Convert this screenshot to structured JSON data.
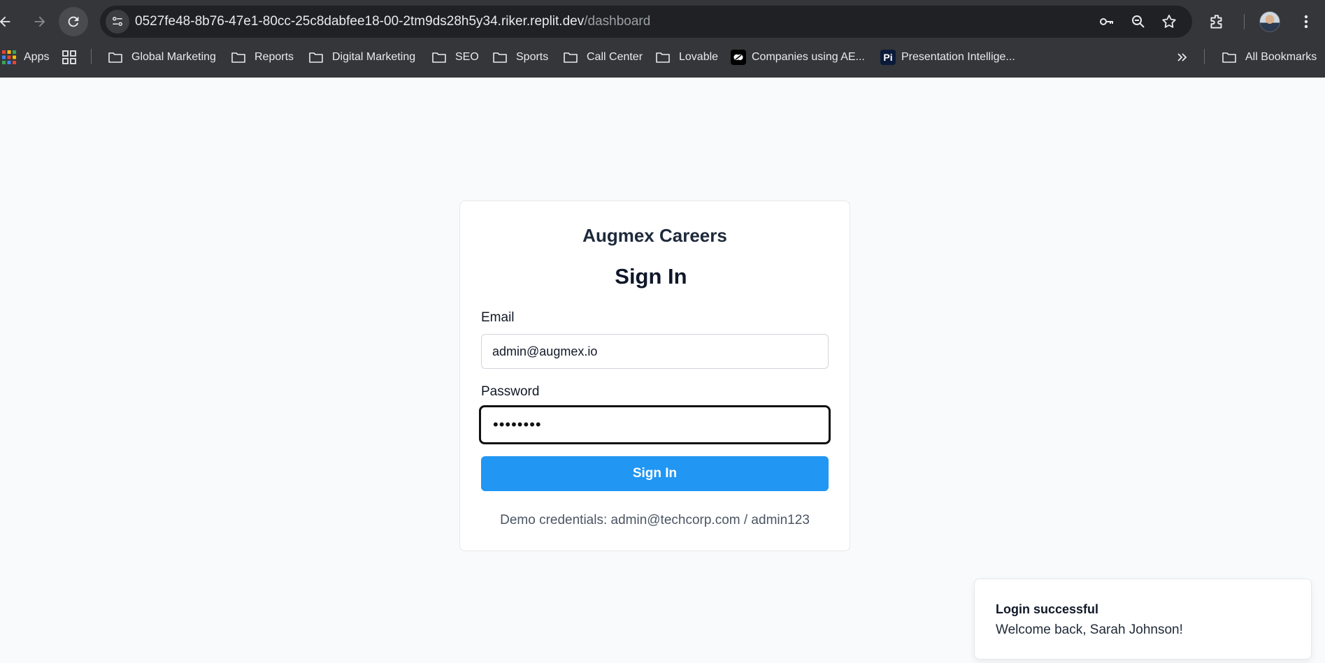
{
  "browser": {
    "url_host": "0527fe48-8b76-47e1-80cc-25c8dabfee18-00-2tm9ds28h5y34.riker.replit.dev",
    "url_path": "/dashboard",
    "bookmarks": [
      {
        "label": "Apps",
        "icon": "apps-grid-icon"
      },
      {
        "label": "Global Marketing",
        "icon": "folder-icon"
      },
      {
        "label": "Reports",
        "icon": "folder-icon"
      },
      {
        "label": "Digital Marketing",
        "icon": "folder-icon"
      },
      {
        "label": "SEO",
        "icon": "folder-icon"
      },
      {
        "label": "Sports",
        "icon": "folder-icon"
      },
      {
        "label": "Call Center",
        "icon": "folder-icon"
      },
      {
        "label": "Lovable",
        "icon": "folder-icon"
      },
      {
        "label": "Companies using AE...",
        "icon": "site-favicon-icon"
      },
      {
        "label": "Presentation Intellige...",
        "icon": "pi-favicon-icon"
      }
    ],
    "all_bookmarks_label": "All Bookmarks",
    "pi_favicon_text": "Pi"
  },
  "login": {
    "brand": "Augmex Careers",
    "title": "Sign In",
    "email_label": "Email",
    "email_value": "admin@augmex.io",
    "password_label": "Password",
    "password_masked": "••••••••",
    "submit_label": "Sign In",
    "demo_text": "Demo credentials: admin@techcorp.com / admin123"
  },
  "toast": {
    "title": "Login successful",
    "message": "Welcome back, Sarah Johnson!"
  },
  "colors": {
    "chrome_bg": "#35363a",
    "omnibox_bg": "#202124",
    "page_bg": "#f8fafc",
    "primary_button": "#2196f3"
  }
}
